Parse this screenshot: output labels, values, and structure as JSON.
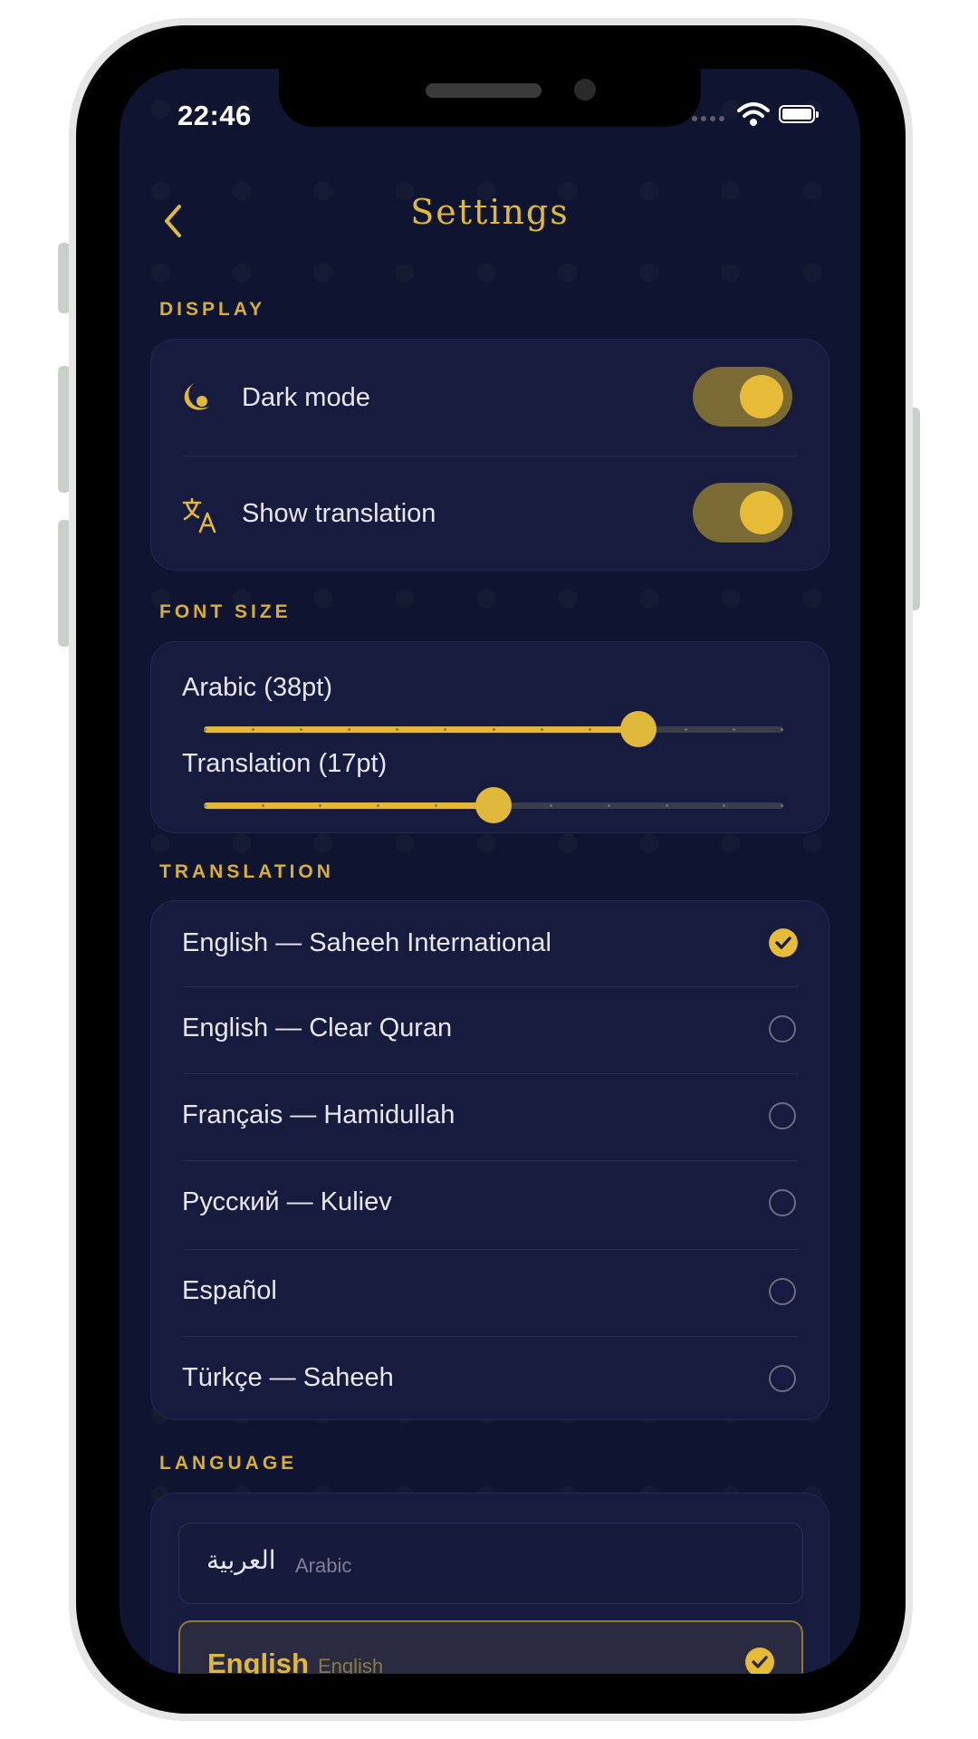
{
  "status_bar": {
    "time": "22:46"
  },
  "header": {
    "title": "Settings",
    "back_icon": "chevron-left-icon"
  },
  "display": {
    "label": "DISPLAY",
    "rows": [
      {
        "label": "Dark mode",
        "icon": "moon-icon",
        "enabled": true
      },
      {
        "label": "Show translation",
        "icon": "translate-icon",
        "enabled": true
      }
    ]
  },
  "font_size": {
    "label": "FONT SIZE",
    "sliders": [
      {
        "label": "Arabic  (38pt)",
        "fraction": 0.75
      },
      {
        "label": "Translation  (17pt)",
        "fraction": 0.5
      }
    ]
  },
  "translation": {
    "label": "TRANSLATION",
    "items": [
      {
        "label": "English — Saheeh International",
        "selected": true
      },
      {
        "label": "English — Clear Quran",
        "selected": false
      },
      {
        "label": "Français — Hamidullah",
        "selected": false
      },
      {
        "label": "Русский — Kuliev",
        "selected": false
      },
      {
        "label": "Español",
        "selected": false
      },
      {
        "label": "Türkçe — Saheeh",
        "selected": false
      }
    ]
  },
  "language": {
    "label": "LANGUAGE",
    "options": [
      {
        "native": "العربية",
        "sub": "Arabic",
        "selected": false
      },
      {
        "native": "English",
        "sub": "English",
        "selected": true
      }
    ]
  },
  "colors": {
    "accent": "#e0b83b",
    "background": "#0f1430",
    "card": "#171c3e",
    "toggle_track": "#7a6a34"
  }
}
